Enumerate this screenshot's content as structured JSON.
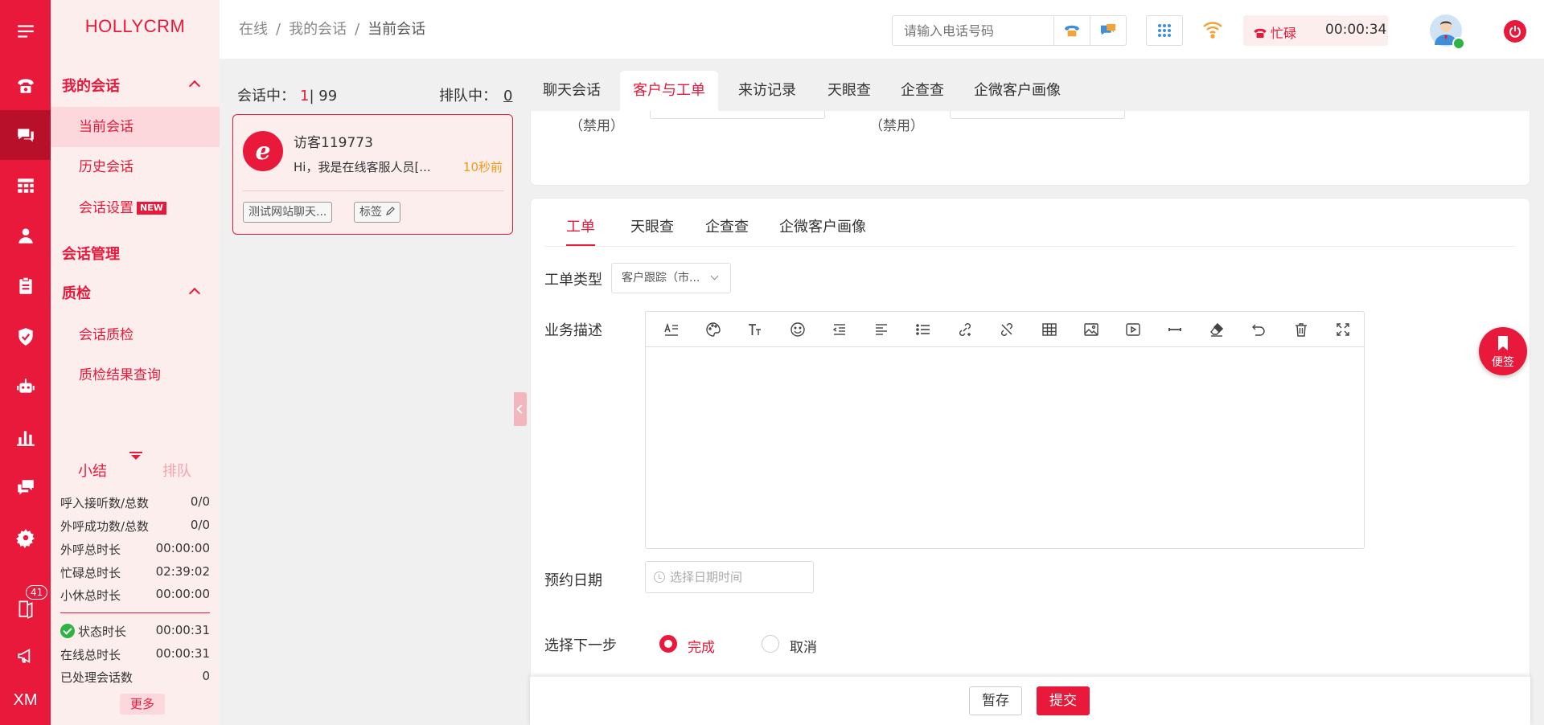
{
  "brand": "HOLLYCRM",
  "rail": {
    "badge": "41",
    "footer": "XM"
  },
  "sidebar": {
    "group1": "我的会话",
    "items1": [
      "当前会话",
      "历史会话",
      "会话设置"
    ],
    "new_tag": "NEW",
    "group2": "会话管理",
    "group3": "质检",
    "items3": [
      "会话质检",
      "质检结果查询"
    ]
  },
  "summary": {
    "tab_active": "小结",
    "tab_inactive": "排队",
    "rows": [
      {
        "label": "呼入接听数/总数",
        "value": "0/0"
      },
      {
        "label": "外呼成功数/总数",
        "value": "0/0"
      },
      {
        "label": "外呼总时长",
        "value": "00:00:00"
      },
      {
        "label": "忙碌总时长",
        "value": "02:39:02"
      },
      {
        "label": "小休总时长",
        "value": "00:00:00"
      },
      {
        "label": "状态时长",
        "value": "00:00:31"
      },
      {
        "label": "在线总时长",
        "value": "00:00:31"
      },
      {
        "label": "已处理会话数",
        "value": "0"
      }
    ],
    "more": "更多"
  },
  "header": {
    "breadcrumb": [
      "在线",
      "我的会话",
      "当前会话"
    ],
    "phone_placeholder": "请输入电话号码",
    "status": "忙碌",
    "timer": "00:00:34"
  },
  "sessions": {
    "label": "会话中：",
    "active": "1",
    "total": "| 99",
    "queue_label": "排队中：",
    "queue_count": "0",
    "card": {
      "name": "访客119773",
      "message": "Hi，我是在线客服人员[...",
      "time": "10秒前",
      "tag1": "测试网站聊天...",
      "tag2": "标签"
    }
  },
  "tabs": [
    "聊天会话",
    "客户与工单",
    "来访记录",
    "天眼查",
    "企查查",
    "企微客户画像"
  ],
  "panel1": {
    "disabled1": "（禁用）",
    "disabled2": "（禁用）"
  },
  "subtabs": [
    "工单",
    "天眼查",
    "企查查",
    "企微客户画像"
  ],
  "form": {
    "type_label": "工单类型",
    "type_value": "客户跟踪（市...",
    "desc_label": "业务描述",
    "date_label": "预约日期",
    "date_placeholder": "选择日期时间",
    "next_label": "选择下一步",
    "option_done": "完成",
    "option_cancel": "取消"
  },
  "footer": {
    "save": "暂存",
    "submit": "提交"
  },
  "sticky_note": "便签",
  "colors": {
    "accent": "#e8193a",
    "rail": "#e8193a",
    "sidebar_bg": "#fdeeee",
    "time": "#f19a18"
  },
  "icons": {
    "rail": [
      "menu-icon",
      "phone-icon",
      "chat-icon",
      "grid-icon",
      "user-icon",
      "clipboard-icon",
      "shield-icon",
      "robot-icon",
      "bar-chart-icon",
      "message-icon",
      "gear-icon",
      "book-icon",
      "megaphone-icon"
    ],
    "toolbar": [
      "heading-icon",
      "palette-icon",
      "font-size-icon",
      "emoji-icon",
      "indent-icon",
      "align-left-icon",
      "list-icon",
      "link-icon",
      "unlink-icon",
      "table-icon",
      "image-icon",
      "video-icon",
      "divider-icon",
      "eraser-icon",
      "undo-icon",
      "trash-icon",
      "fullscreen-icon"
    ]
  }
}
